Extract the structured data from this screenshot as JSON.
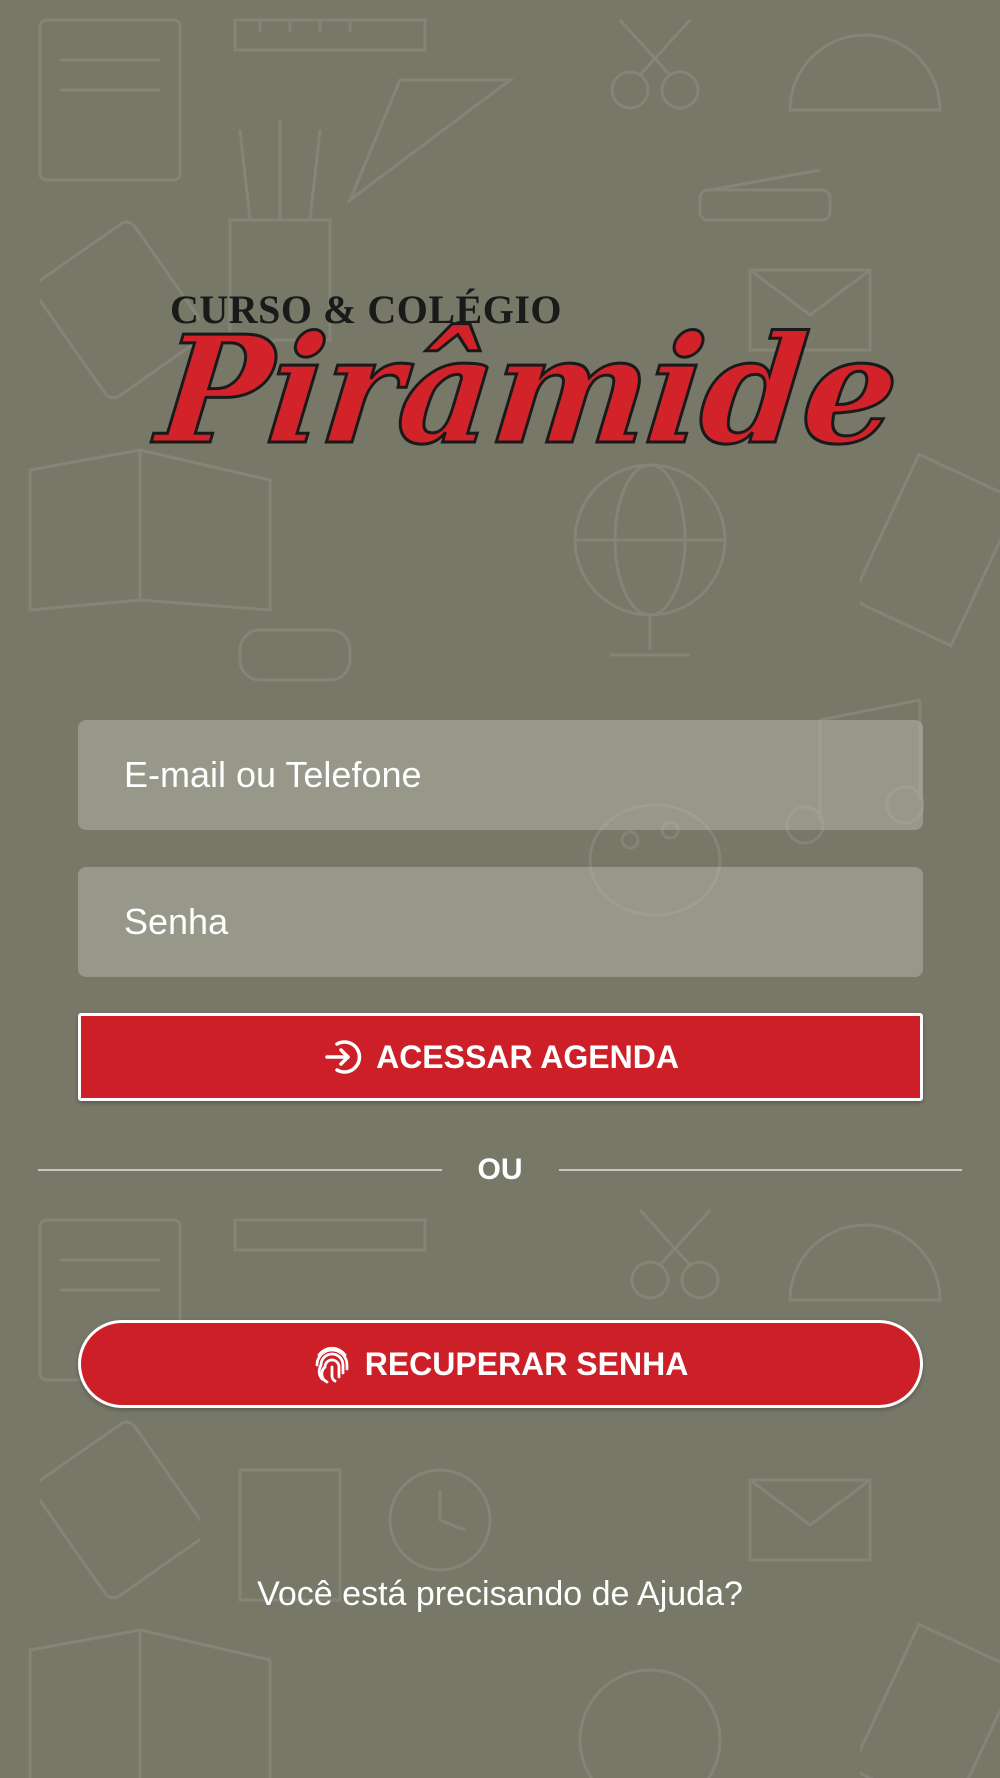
{
  "logo": {
    "top_text": "CURSO & COLÉGIO",
    "main_text": "Pirâmide"
  },
  "login_form": {
    "email_placeholder": "E-mail ou Telefone",
    "password_placeholder": "Senha",
    "access_button_label": "ACESSAR AGENDA",
    "access_button_icon": "login-arrow-icon"
  },
  "divider": {
    "label": "OU"
  },
  "recover": {
    "button_label": "RECUPERAR SENHA",
    "button_icon": "fingerprint-icon"
  },
  "help_link": "Você está precisando de Ajuda?",
  "colors": {
    "background": "#777868",
    "accent_red": "#cc1f27",
    "input_bg": "rgba(190,190,178,0.45)"
  }
}
